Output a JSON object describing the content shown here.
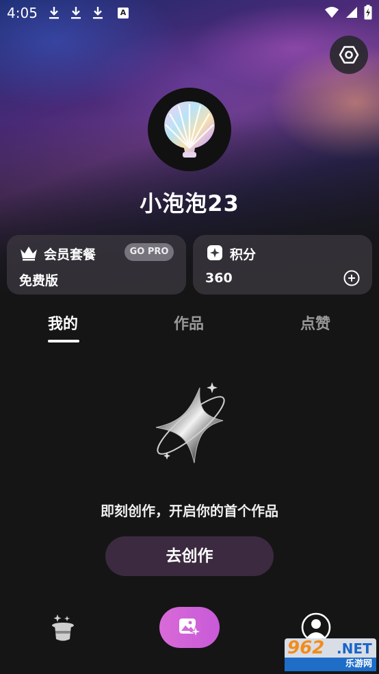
{
  "status_bar": {
    "time": "4:05",
    "badge_letter": "A"
  },
  "profile": {
    "username": "小泡泡23"
  },
  "membership_card": {
    "title": "会员套餐",
    "plan": "免费版",
    "badge": "GO PRO"
  },
  "points_card": {
    "title": "积分",
    "value": "360"
  },
  "tabs": [
    {
      "label": "我的",
      "active": true
    },
    {
      "label": "作品",
      "active": false
    },
    {
      "label": "点赞",
      "active": false
    }
  ],
  "empty_state": {
    "message": "即刻创作，开启你的首个作品",
    "button_label": "去创作"
  },
  "watermark": {
    "number": "962",
    "suffix": ".NET",
    "site": "乐游网"
  },
  "colors": {
    "background": "#151515",
    "create_button": "#3b2a40",
    "nav_accent": "#d86ad8"
  }
}
